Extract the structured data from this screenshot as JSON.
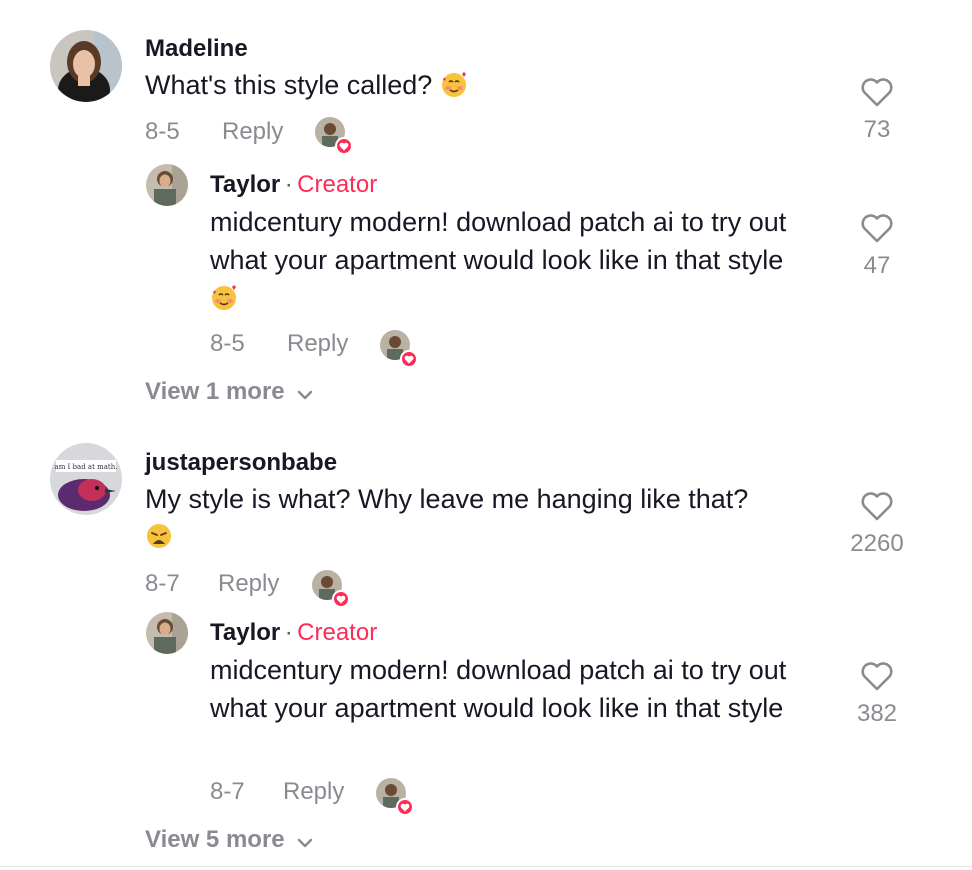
{
  "comments": [
    {
      "username": "Madeline",
      "text": "What's this style called?",
      "date": "8-5",
      "reply_label": "Reply",
      "likes": "73",
      "reply": {
        "username": "Taylor",
        "separator": "·",
        "creator_label": "Creator",
        "text": "midcentury modern! download patch ai to try out what your apartment would look like in that style",
        "date": "8-5",
        "reply_label": "Reply",
        "likes": "47"
      },
      "view_more": "View 1 more"
    },
    {
      "username": "justapersonbabe",
      "avatar_caption": "am I bad at math.",
      "text": "My style is what? Why leave me hanging like that?",
      "date": "8-7",
      "reply_label": "Reply",
      "likes": "2260",
      "reply": {
        "username": "Taylor",
        "separator": "·",
        "creator_label": "Creator",
        "text": "midcentury modern! download patch ai to try out what your apartment would look like in that style",
        "date": "8-7",
        "reply_label": "Reply",
        "likes": "382"
      },
      "view_more": "View 5 more"
    }
  ],
  "colors": {
    "accent": "#fe2c55",
    "muted": "#8a8b91",
    "text": "#161823"
  },
  "icons": {
    "like": "heart-outline-icon",
    "expand": "chevron-down-icon",
    "emoji_love": "smiling-face-with-hearts-emoji",
    "emoji_weary": "weary-face-emoji"
  }
}
